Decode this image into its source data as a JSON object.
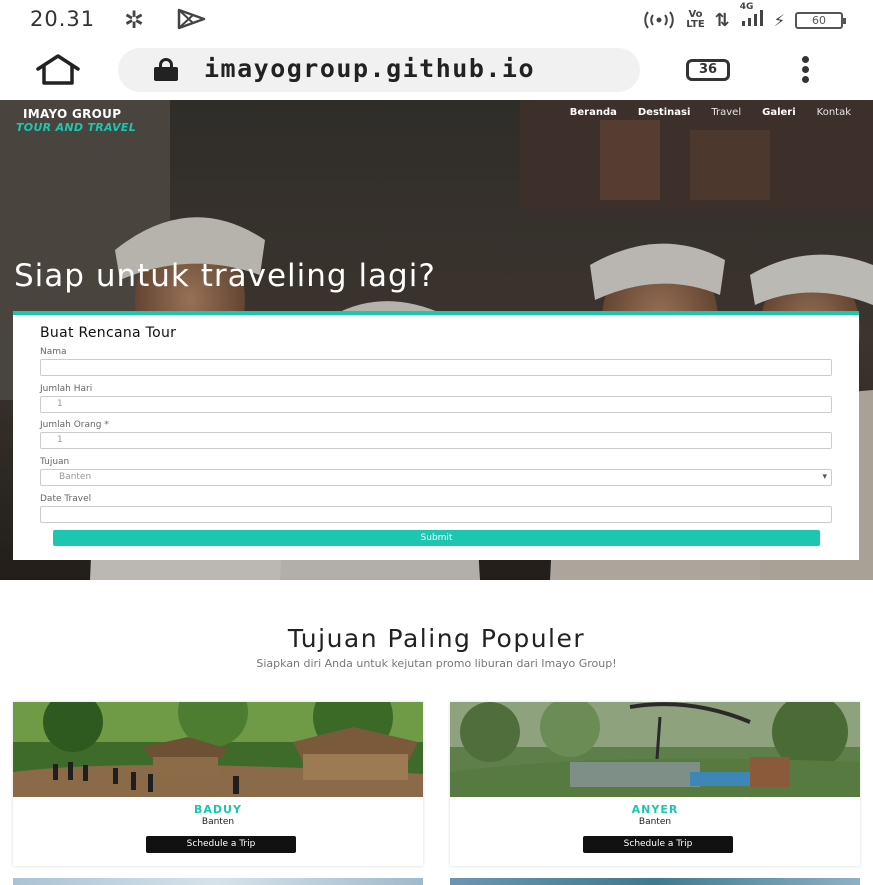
{
  "status_bar": {
    "time": "20.31",
    "icons": [
      "gear-icon",
      "play-store-icon",
      "hotspot-icon",
      "volte-icon",
      "data-arrows-icon",
      "signal-icon",
      "no-charge-icon",
      "battery-icon"
    ],
    "volte_top": "Vo",
    "volte_bottom": "LTE",
    "network": "4G",
    "battery": "60"
  },
  "browser": {
    "url": "imayogroup.github.io",
    "tab_count": "36"
  },
  "site": {
    "brand_name": "IMAYO GROUP",
    "brand_tagline": "TOUR AND TRAVEL",
    "nav": [
      "Beranda",
      "Destinasi",
      "Travel",
      "Galeri",
      "Kontak"
    ],
    "hero_title": "Siap untuk traveling lagi?"
  },
  "form": {
    "title": "Buat Rencana Tour",
    "name_label": "Nama",
    "name_value": "",
    "days_label": "Jumlah Hari",
    "days_value": "1",
    "people_label": "Jumlah Orang *",
    "people_value": "1",
    "destination_label": "Tujuan",
    "destination_value": "Banten",
    "date_label": "Date Travel",
    "date_value": "",
    "submit_label": "Submit"
  },
  "popular": {
    "title": "Tujuan Paling Populer",
    "subtitle": "Siapkan diri Anda untuk kejutan promo liburan dari Imayo Group!",
    "cards": [
      {
        "name": "BADUY",
        "region": "Banten",
        "button": "Schedule a Trip"
      },
      {
        "name": "ANYER",
        "region": "Banten",
        "button": "Schedule a Trip"
      }
    ]
  },
  "colors": {
    "accent": "#1cc6b0",
    "dark_button": "#111111"
  }
}
